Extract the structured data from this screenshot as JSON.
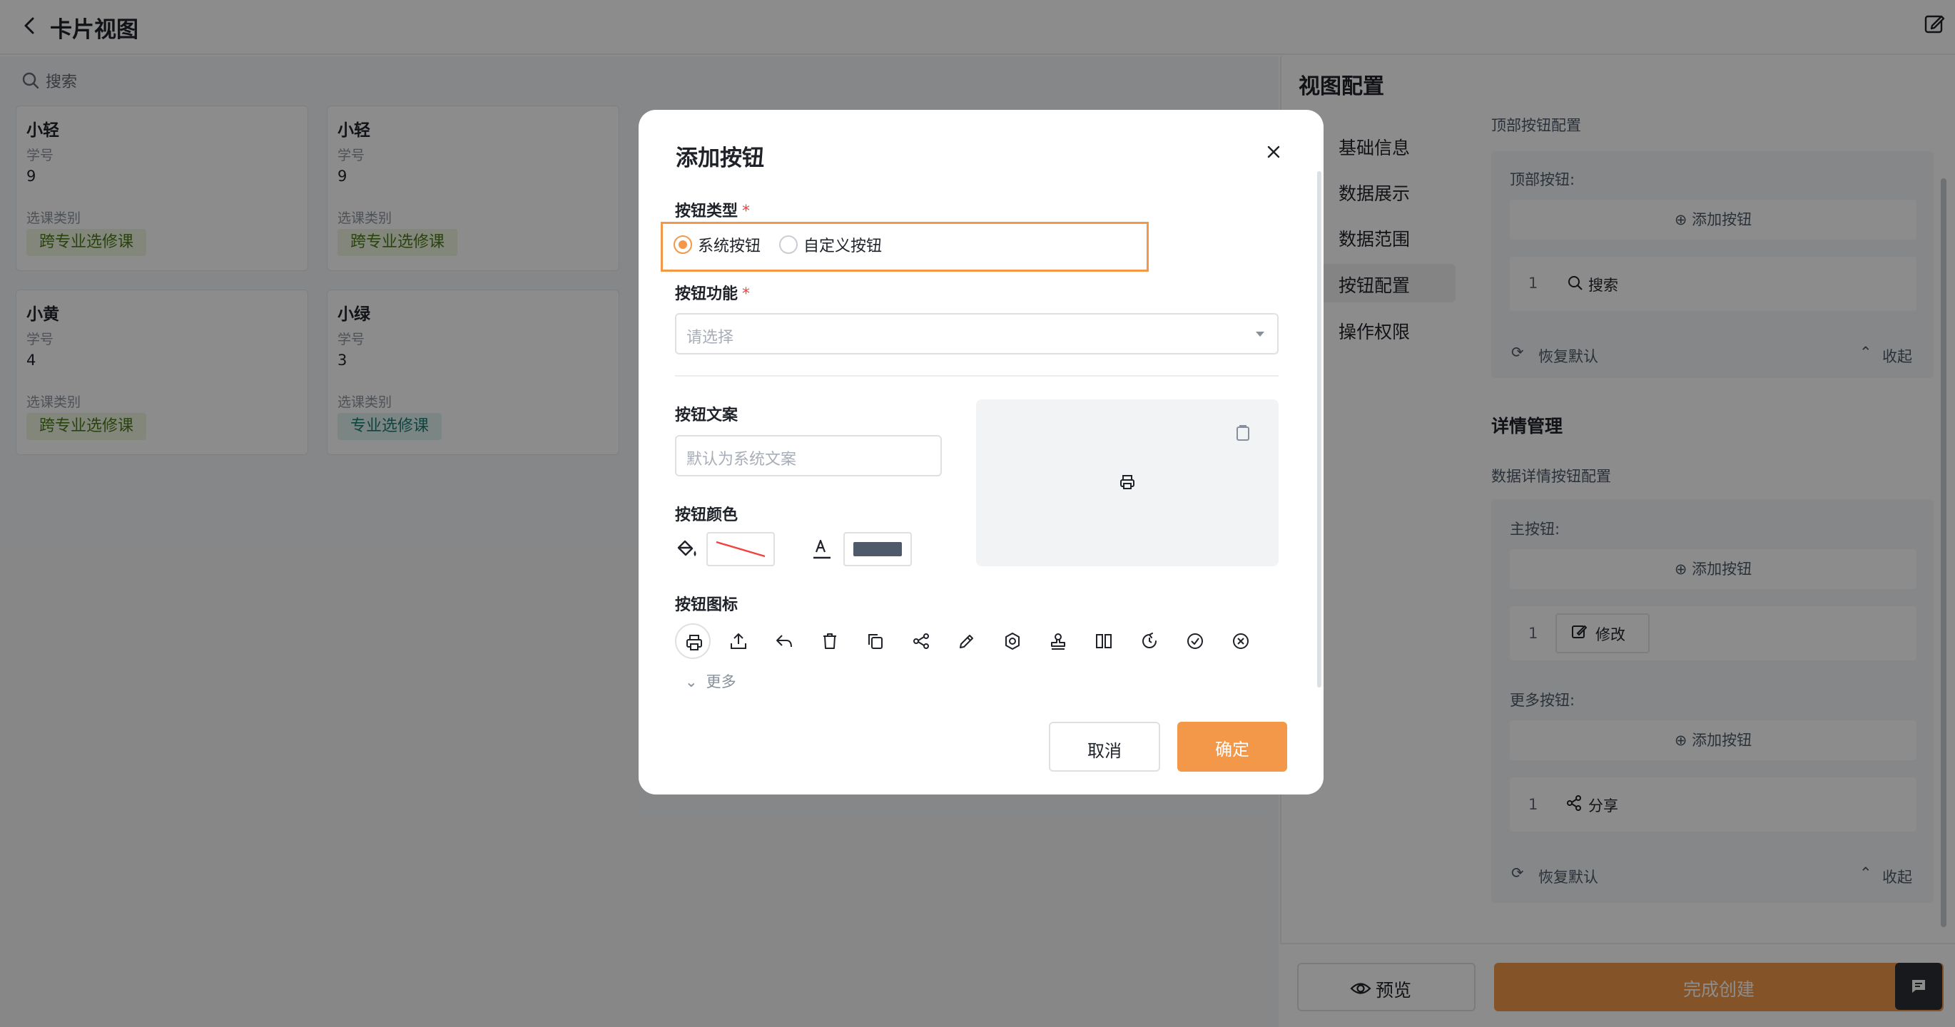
{
  "header": {
    "title": "卡片视图"
  },
  "search": {
    "placeholder": "搜索"
  },
  "cards": [
    {
      "name": "小轻",
      "field1_label": "学号",
      "field1_value": "9",
      "field2_label": "选课类别",
      "tag": "跨专业选修课"
    },
    {
      "name": "小轻",
      "field1_label": "学号",
      "field1_value": "9",
      "field2_label": "选课类别",
      "tag": "跨专业选修课"
    },
    {
      "name": "小黄",
      "field1_label": "学号",
      "field1_value": "4",
      "field2_label": "选课类别",
      "tag": "跨专业选修课"
    },
    {
      "name": "小绿",
      "field1_label": "学号",
      "field1_value": "3",
      "field2_label": "选课类别",
      "tag": "专业选修课"
    }
  ],
  "config": {
    "title": "视图配置",
    "nav": [
      "基础信息",
      "数据展示",
      "数据范围",
      "按钮配置",
      "操作权限"
    ],
    "active_nav": "按钮配置",
    "top_section_label": "顶部按钮配置",
    "top_buttons_label": "顶部按钮:",
    "add_button": "添加按钮",
    "top_item": {
      "index": "1",
      "label": "搜索"
    },
    "restore": "恢复默认",
    "collapse": "收起",
    "detail_heading": "详情管理",
    "detail_config_label": "数据详情按钮配置",
    "main_buttons_label": "主按钮:",
    "main_item": {
      "index": "1",
      "label": "修改"
    },
    "more_buttons_label": "更多按钮:",
    "more_item": {
      "index": "1",
      "label": "分享"
    },
    "preview": "预览",
    "finish": "完成创建"
  },
  "modal": {
    "title": "添加按钮",
    "type_label": "按钮类型",
    "type_options": [
      "系统按钮",
      "自定义按钮"
    ],
    "type_selected": "系统按钮",
    "function_label": "按钮功能",
    "function_placeholder": "请选择",
    "text_label": "按钮文案",
    "text_placeholder": "默认为系统文案",
    "color_label": "按钮颜色",
    "icon_label": "按钮图标",
    "icons": [
      "printer-icon",
      "upload-icon",
      "reply-icon",
      "trash-icon",
      "copy-icon",
      "share-icon",
      "pen-icon",
      "settings-icon",
      "stamp-icon",
      "columns-icon",
      "refresh-icon",
      "check-circle-icon",
      "close-circle-icon"
    ],
    "selected_icon": "printer-icon",
    "more": "更多",
    "cancel": "取消",
    "ok": "确定",
    "accent_color": "#f39849",
    "font_color": "#4e5969"
  }
}
